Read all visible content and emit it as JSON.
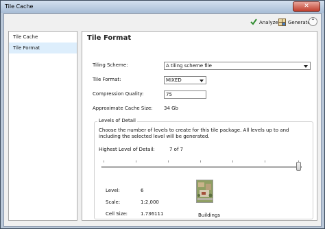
{
  "window": {
    "title": "Tile Cache",
    "close_glyph": "✕"
  },
  "toolbar": {
    "analyze_label": "Analyze",
    "generate_label": "Generate",
    "analyze_icon": "checkmark-icon",
    "generate_icon": "generate-grid-icon",
    "collapse_icon": "chevron-up-circle-icon",
    "collapse_glyph": "⌃"
  },
  "sidebar": {
    "items": [
      {
        "label": "Tile Cache",
        "selected": false
      },
      {
        "label": "Tile Format",
        "selected": true
      }
    ]
  },
  "main": {
    "title": "Tile Format",
    "tiling_scheme": {
      "label": "Tiling Scheme:",
      "value": "A tiling scheme file"
    },
    "tile_format": {
      "label": "Tile Format:",
      "value": "MIXED"
    },
    "compression_quality": {
      "label": "Compression Quality:",
      "value": "75"
    },
    "cache_size": {
      "label": "Approximate Cache Size:",
      "value": "34 Gb"
    },
    "lod": {
      "legend": "Levels of Detail",
      "description": "Choose the number of levels to create for this tile package.   All levels up to and including the selected level will be generated.",
      "highest_label": "Highest Level of Detail:",
      "highest_value": "7 of 7",
      "slider_level": 7,
      "slider_max": 7,
      "level_label": "Level:",
      "level_value": "6",
      "scale_label": "Scale:",
      "scale_value": "1:2,000",
      "cellsize_label": "Cell Size:",
      "cellsize_value": "1.736111",
      "thumbnail_caption": "Buildings"
    }
  },
  "colors": {
    "accent_green": "#2e8b2e",
    "selection_bg": "#ddeefc",
    "close_red": "#c1402f"
  }
}
